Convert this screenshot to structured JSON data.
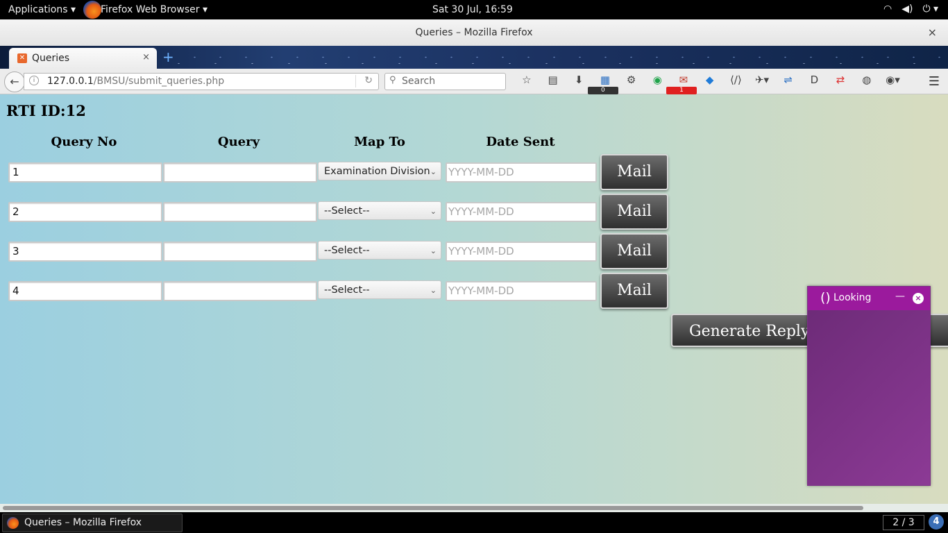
{
  "topbar": {
    "applications": "Applications ▾",
    "app_menu": "Firefox Web Browser ▾",
    "clock": "Sat 30 Jul, 16:59",
    "system_icons": [
      "wifi-icon",
      "volume-icon",
      "power-icon"
    ]
  },
  "window": {
    "title": "Queries – Mozilla Firefox",
    "close": "×"
  },
  "tabs": [
    {
      "label": "Queries",
      "close": "×"
    }
  ],
  "newtab": "+",
  "navbar": {
    "url_host": "127.0.0.1",
    "url_path": "/BMSU/submit_queries.php",
    "search_placeholder": "Search",
    "toolbar_icons": [
      "bookmark-star-icon",
      "reading-list-icon",
      "download-icon",
      "extension-0-icon",
      "extension-icon",
      "globe-green-icon",
      "mail-extension-icon",
      "gem-icon",
      "code-icon",
      "satellite-icon",
      "translate-icon",
      "d-icon",
      "swap-icon",
      "privacy-icon",
      "eye-icon"
    ],
    "badges": {
      "extension_count": "0",
      "mail_count": "1"
    },
    "menu_icon": "hamburger-icon"
  },
  "page": {
    "rti_label": "RTI ID:",
    "rti_value": "12",
    "headers": {
      "query_no": "Query No",
      "query": "Query",
      "map_to": "Map To",
      "date_sent": "Date Sent"
    },
    "rows": [
      {
        "query_no": "1",
        "query": "",
        "map_to": "Examination Division",
        "date_placeholder": "YYYY-MM-DD",
        "mail": "Mail"
      },
      {
        "query_no": "2",
        "query": "",
        "map_to": "--Select--",
        "date_placeholder": "YYYY-MM-DD",
        "mail": "Mail"
      },
      {
        "query_no": "3",
        "query": "",
        "map_to": "--Select--",
        "date_placeholder": "YYYY-MM-DD",
        "mail": "Mail"
      },
      {
        "query_no": "4",
        "query": "",
        "map_to": "--Select--",
        "date_placeholder": "YYYY-MM-DD",
        "mail": "Mail"
      }
    ],
    "generate_reply": "Generate Reply"
  },
  "popup": {
    "icon_text": "()",
    "title": "Looking",
    "minimize": "—",
    "close": "×"
  },
  "bottombar": {
    "task_label": "Queries – Mozilla Firefox",
    "workspace": "2 / 3",
    "notifications": "4"
  }
}
